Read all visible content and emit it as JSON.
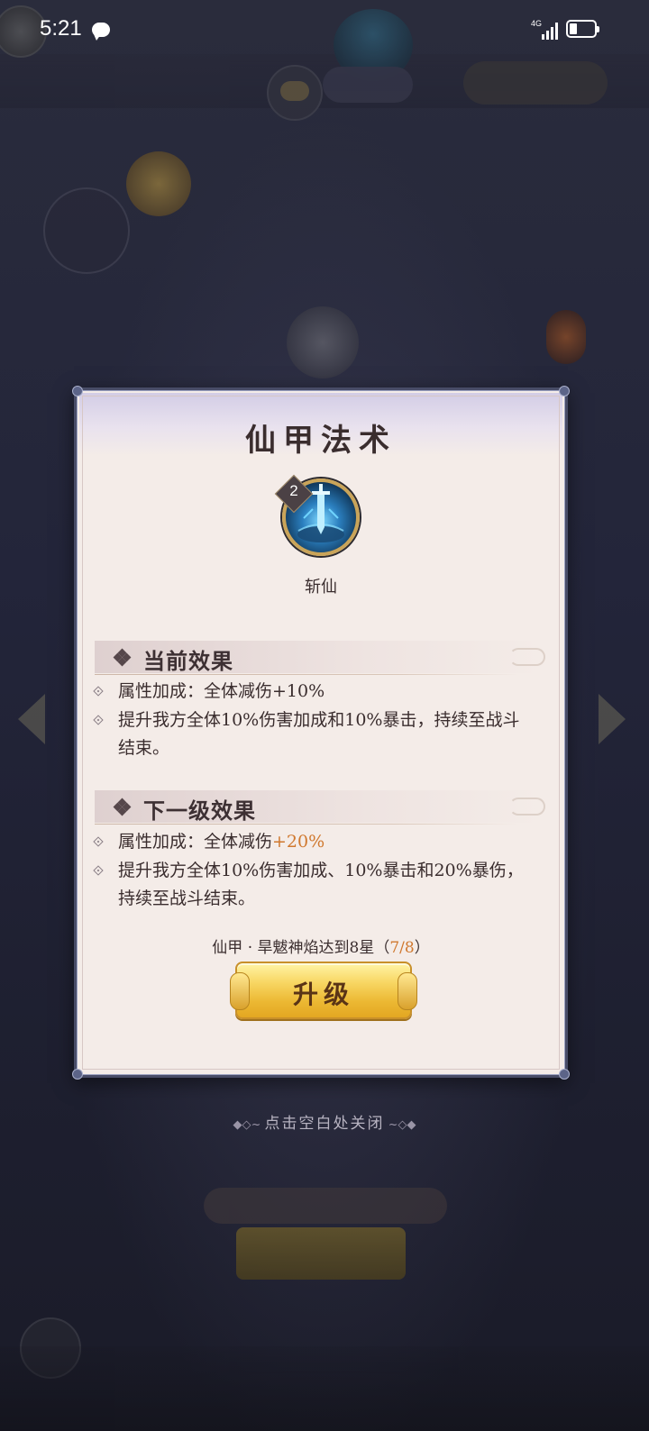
{
  "status_bar": {
    "time": "5:21",
    "network": "4G",
    "icons": [
      "message-icon",
      "signal-icon",
      "battery-icon"
    ]
  },
  "dialog": {
    "title": "仙甲法术",
    "skill": {
      "level": "2",
      "name": "斩仙",
      "icon": "sword-skill-icon"
    },
    "current_effect": {
      "title": "当前效果",
      "items": [
        "属性加成：全体减伤+10%",
        "提升我方全体10%伤害加成和10%暴击，持续至战斗结束。"
      ]
    },
    "next_effect": {
      "title": "下一级效果",
      "attr_prefix": "属性加成：全体减伤",
      "attr_value": "+20%",
      "items": [
        "提升我方全体10%伤害加成、10%暴击和20%暴伤，持续至战斗结束。"
      ]
    },
    "requirement": {
      "text": "仙甲 · 旱魃神焰达到8星",
      "progress": "7/8"
    },
    "upgrade_button": "升级",
    "colors": {
      "accent": "#d0782e",
      "border": "#484c67",
      "panel": "#f4ece8",
      "button": "#f8d764"
    }
  },
  "close_hint": "点击空白处关闭"
}
